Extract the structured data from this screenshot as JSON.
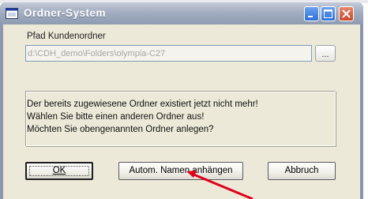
{
  "window": {
    "title": "Ordner-System",
    "controls": {
      "minimize": "minimize-icon",
      "maximize": "maximize-icon",
      "close": "close-icon"
    }
  },
  "form": {
    "path_label": "Pfad Kundenordner",
    "path_value": "d:\\CDH_demo\\Folders\\olympia-C27",
    "browse_label": "..."
  },
  "message": {
    "lines": [
      "Der bereits zugewiesene Ordner existiert jetzt nicht mehr!",
      "Wählen Sie bitte einen anderen Ordner aus!",
      "Möchten Sie obengenannten Ordner anlegen?"
    ]
  },
  "buttons": {
    "ok": "OK",
    "auto_name": "Autom. Namen anhängen",
    "cancel": "Abbruch"
  },
  "colors": {
    "title_bar": "#98a4b9",
    "client": "#ece9d8",
    "close": "#c7472b",
    "arrow": "#e0001a"
  }
}
